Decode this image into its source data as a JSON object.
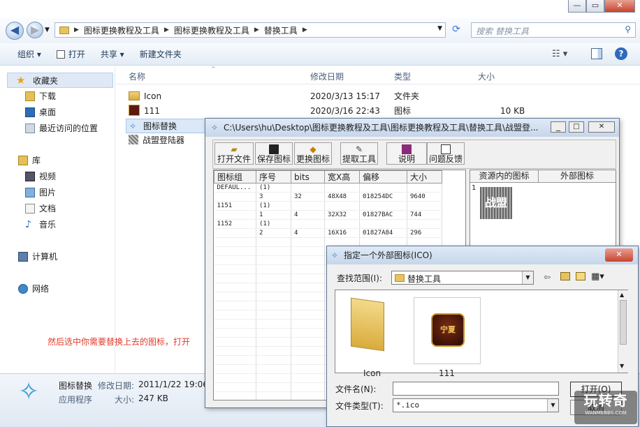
{
  "explorer": {
    "breadcrumb": [
      "图标更换教程及工具",
      "图标更换教程及工具",
      "替换工具"
    ],
    "search_placeholder": "搜索 替换工具",
    "toolbar": {
      "organize": "组织 ▾",
      "open": "打开",
      "share": "共享 ▾",
      "new_folder": "新建文件夹"
    },
    "sidebar": {
      "favorites": "收藏夹",
      "fav_items": [
        "下载",
        "桌面",
        "最近访问的位置"
      ],
      "library": "库",
      "lib_items": [
        "视频",
        "图片",
        "文档",
        "音乐"
      ],
      "computer": "计算机",
      "network": "网络"
    },
    "columns": {
      "name": "名称",
      "date": "修改日期",
      "type": "类型",
      "size": "大小"
    },
    "files": [
      {
        "name": "Icon",
        "date": "2020/3/13 15:17",
        "type": "文件夹",
        "size": ""
      },
      {
        "name": "111",
        "date": "2020/3/16 22:43",
        "type": "图标",
        "size": "10 KB"
      },
      {
        "name": "图标替换",
        "date": "",
        "type": "",
        "size": ""
      },
      {
        "name": "战盟登陆器",
        "date": "",
        "type": "",
        "size": ""
      }
    ],
    "details": {
      "name": "图标替换",
      "date_label": "修改日期:",
      "date": "2011/1/22 19:06",
      "kind": "应用程序",
      "size_label": "大小:",
      "size": "247 KB"
    },
    "annotation": "然后选中你需要替换上去的图标，打开"
  },
  "replacer": {
    "title": "C:\\Users\\hu\\Desktop\\图标更换教程及工具\\图标更换教程及工具\\替换工具\\战盟登...",
    "buttons": [
      "打开文件",
      "保存图标",
      "更换图标",
      "提取工具",
      "说明",
      "问题反馈"
    ],
    "columns": [
      "图标组",
      "序号",
      "bits",
      "宽X高",
      "偏移",
      "大小"
    ],
    "rows": [
      [
        "DEFAUL...",
        "(1)",
        "",
        "",
        "",
        ""
      ],
      [
        "",
        "3",
        "32",
        "48X48",
        "018254DC",
        "9640"
      ],
      [
        "1151",
        "(1)",
        "",
        "",
        "",
        ""
      ],
      [
        "",
        "1",
        "4",
        "32X32",
        "01827BAC",
        "744"
      ],
      [
        "1152",
        "(1)",
        "",
        "",
        "",
        ""
      ],
      [
        "",
        "2",
        "4",
        "16X16",
        "01827A84",
        "296"
      ]
    ],
    "right_cols": [
      "资源内的图标",
      "外部图标"
    ],
    "res_index": "1",
    "res_icon_text": "战盟"
  },
  "file_dialog": {
    "title": "指定一个外部图标(ICO)",
    "look_in_label": "查找范围(I):",
    "look_in_value": "替换工具",
    "items": [
      {
        "label": "Icon"
      },
      {
        "label": "111"
      }
    ],
    "icon_text": "宁夏",
    "filename_label": "文件名(N):",
    "filename_value": "",
    "filetype_label": "文件类型(T):",
    "filetype_value": "*.ico",
    "open_button": "打开(O)",
    "cancel_button": "取消"
  },
  "watermark": {
    "text": "玩转奇",
    "sub": "WANMEBBS.COM"
  }
}
